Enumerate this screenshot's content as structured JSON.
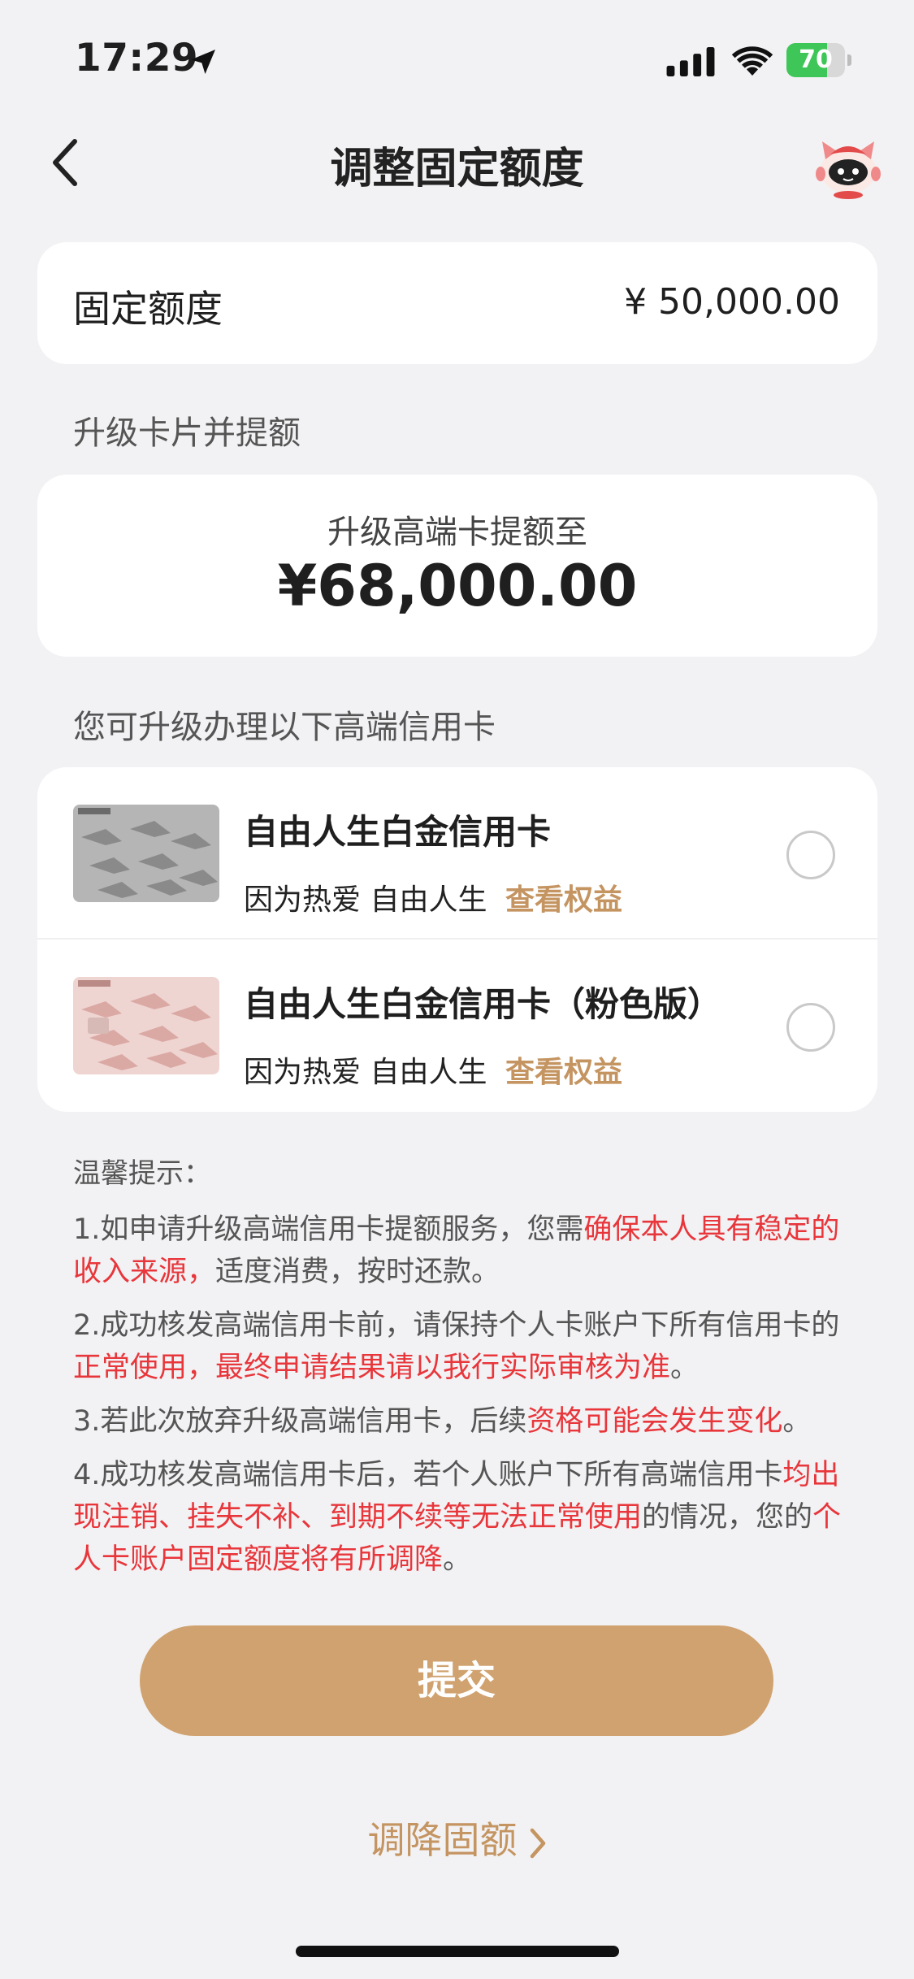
{
  "status_bar": {
    "time": "17:29",
    "battery": "70",
    "battery_level": 0.7,
    "icons": [
      "location-arrow-icon",
      "signal-icon",
      "wifi-icon",
      "battery-charging-icon"
    ]
  },
  "nav": {
    "title": "调整固定额度",
    "back_icon": "chevron-left-icon",
    "assistant_icon": "mascot-assistant-icon"
  },
  "limit": {
    "label": "固定额度",
    "value": "¥ 50,000.00"
  },
  "upgrade_section": {
    "title": "升级卡片并提额",
    "subtitle": "升级高端卡提额至",
    "amount": "¥68,000.00"
  },
  "cards_section": {
    "title": "您可升级办理以下高端信用卡",
    "cards": [
      {
        "name": "自由人生白金信用卡",
        "desc": "因为热爱 自由人生",
        "benefit_link": "查看权益",
        "selected": false,
        "thumb_color": "#a9a9a9"
      },
      {
        "name": "自由人生白金信用卡（粉色版）",
        "desc": "因为热爱 自由人生",
        "benefit_link": "查看权益",
        "selected": false,
        "thumb_color": "#e8c3c0"
      }
    ]
  },
  "tips": {
    "title": "温馨提示：",
    "items": [
      {
        "parts": [
          {
            "text": "1.如申请升级高端信用卡提额服务，您需",
            "red": false
          },
          {
            "text": "确保本人具有稳定的收入来源，",
            "red": true
          },
          {
            "text": "适度消费，按时还款。",
            "red": false
          }
        ]
      },
      {
        "parts": [
          {
            "text": "2.成功核发高端信用卡前，请保持个人卡账户下所有信用卡的",
            "red": false
          },
          {
            "text": "正常使用，最终申请结果请以我行实际审核为准",
            "red": true
          },
          {
            "text": "。",
            "red": false
          }
        ]
      },
      {
        "parts": [
          {
            "text": "3.若此次放弃升级高端信用卡，后续",
            "red": false
          },
          {
            "text": "资格可能会发生变化",
            "red": true
          },
          {
            "text": "。",
            "red": false
          }
        ]
      },
      {
        "parts": [
          {
            "text": "4.成功核发高端信用卡后，若个人账户下所有高端信用卡",
            "red": false
          },
          {
            "text": "均出现注销、挂失不补、到期不续等无法正常使用",
            "red": true
          },
          {
            "text": "的情况，您的",
            "red": false
          },
          {
            "text": "个人卡账户固定额度将有所调降",
            "red": true
          },
          {
            "text": "。",
            "red": false
          }
        ]
      }
    ]
  },
  "actions": {
    "submit_label": "提交",
    "reduce_label": "调降固额"
  }
}
